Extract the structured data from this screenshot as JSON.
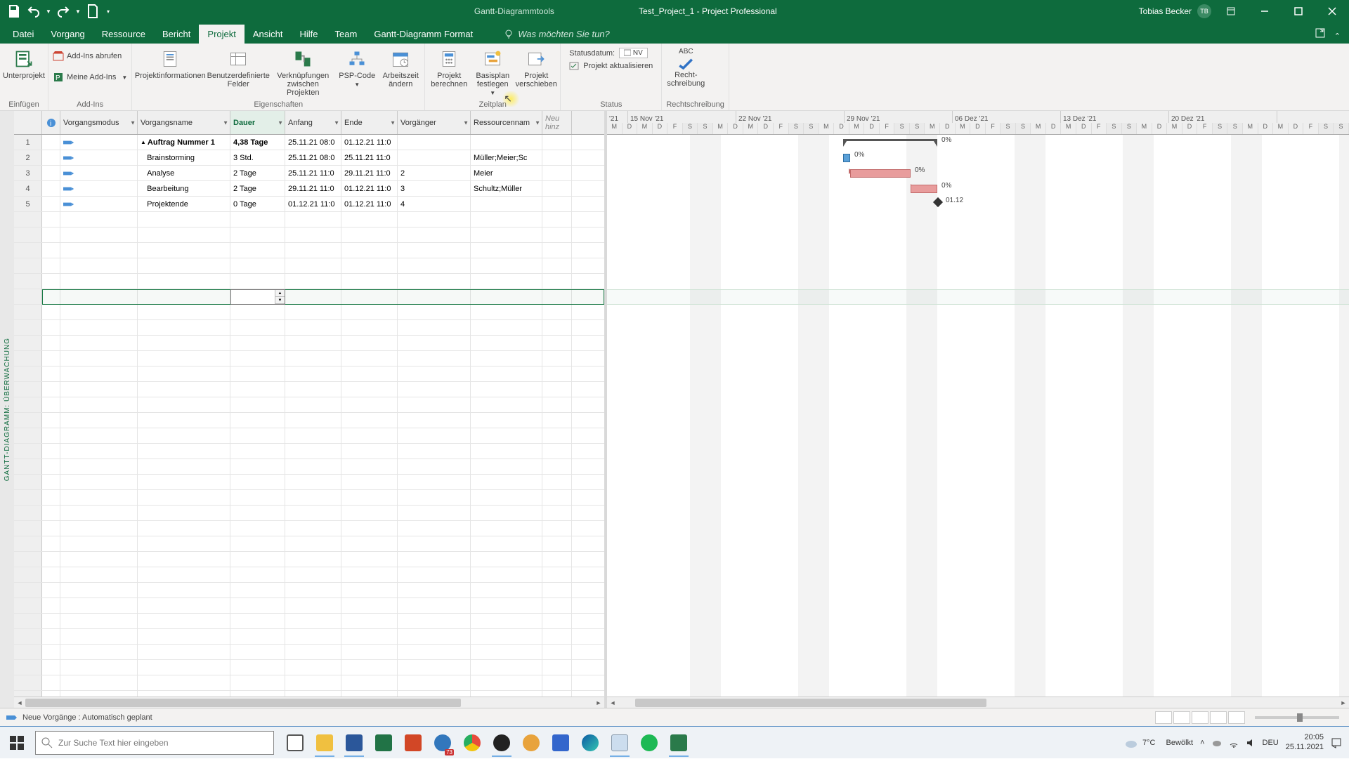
{
  "titlebar": {
    "tool_context": "Gantt-Diagrammtools",
    "filename": "Test_Project_1",
    "app": "Project Professional",
    "user": "Tobias Becker",
    "initials": "TB"
  },
  "menu": {
    "tabs": [
      "Datei",
      "Vorgang",
      "Ressource",
      "Bericht",
      "Projekt",
      "Ansicht",
      "Hilfe",
      "Team",
      "Gantt-Diagramm Format"
    ],
    "active": 4,
    "search_placeholder": "Was möchten Sie tun?"
  },
  "ribbon": {
    "groups": [
      {
        "label": "Einfügen",
        "big": [
          "Unterprojekt"
        ]
      },
      {
        "label": "Add-Ins",
        "small": [
          "Add-Ins abrufen",
          "Meine Add-Ins"
        ]
      },
      {
        "label": "Eigenschaften",
        "big": [
          "Projektinformationen",
          "Benutzerdefinierte Felder",
          "Verknüpfungen zwischen Projekten",
          "PSP-Code",
          "Arbeitszeit ändern"
        ]
      },
      {
        "label": "Zeitplan",
        "big": [
          "Projekt berechnen",
          "Basisplan festlegen",
          "Projekt verschieben"
        ]
      },
      {
        "label": "Status",
        "status_label": "Statusdatum:",
        "status_value": "NV",
        "update_label": "Projekt aktualisieren"
      },
      {
        "label": "Rechtschreibung",
        "big": [
          "Recht-schreibung"
        ],
        "abc": "ABC"
      }
    ]
  },
  "columns": {
    "info": "",
    "mode": "Vorgangsmodus",
    "name": "Vorgangsname",
    "dauer": "Dauer",
    "anfang": "Anfang",
    "ende": "Ende",
    "vorgaenger": "Vorgänger",
    "ressourcen": "Ressourcennam",
    "neu": "Neu hinz"
  },
  "rows": [
    {
      "num": "1",
      "name": "Auftrag Nummer 1",
      "bold": true,
      "collapse": "▲",
      "dauer": "4,38 Tage",
      "anfang": "25.11.21 08:0",
      "ende": "01.12.21 11:0",
      "vorg": "",
      "res": ""
    },
    {
      "num": "2",
      "name": "Brainstorming",
      "dauer": "3 Std.",
      "anfang": "25.11.21 08:0",
      "ende": "25.11.21 11:0",
      "vorg": "",
      "res": "Müller;Meier;Sc"
    },
    {
      "num": "3",
      "name": "Analyse",
      "dauer": "2 Tage",
      "anfang": "25.11.21 11:0",
      "ende": "29.11.21 11:0",
      "vorg": "2",
      "res": "Meier"
    },
    {
      "num": "4",
      "name": "Bearbeitung",
      "dauer": "2 Tage",
      "anfang": "29.11.21 11:0",
      "ende": "01.12.21 11:0",
      "vorg": "3",
      "res": "Schultz;Müller"
    },
    {
      "num": "5",
      "name": "Projektende",
      "dauer": "0 Tage",
      "anfang": "01.12.21 11:0",
      "ende": "01.12.21 11:0",
      "vorg": "4",
      "res": ""
    }
  ],
  "sidebar": {
    "label": "GANTT-DIAGRAMM: ÜBERWACHUNG"
  },
  "timeline": {
    "first": "'21",
    "weeks": [
      "15 Nov '21",
      "22 Nov '21",
      "29 Nov '21",
      "06 Dez '21",
      "13 Dez '21",
      "20 Dez '21"
    ],
    "day_letters": [
      "M",
      "D",
      "M",
      "D",
      "F",
      "S",
      "S"
    ]
  },
  "gantt": {
    "pct0": "0%",
    "ms_date": "01.12"
  },
  "statusbar": {
    "mode_text": "Neue Vorgänge : Automatisch geplant"
  },
  "taskbar": {
    "search_placeholder": "Zur Suche Text hier eingeben",
    "weather_temp": "7°C",
    "weather_text": "Bewölkt",
    "time": "20:05",
    "date": "25.11.2021",
    "lang": "DEU",
    "badge": "73"
  }
}
